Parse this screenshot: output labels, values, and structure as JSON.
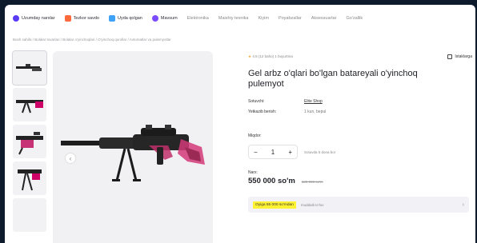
{
  "nav": {
    "items": [
      {
        "label": "Uzumday narxlar",
        "color": "#5b3cf5",
        "icon": "tag-icon"
      },
      {
        "label": "Tezkor savdo",
        "color": "#ff6a3d",
        "icon": "bolt-icon"
      },
      {
        "label": "Uyda qolgan",
        "color": "#3fa2f7",
        "icon": "home-icon"
      },
      {
        "label": "Mavsum",
        "color": "#7b4bff",
        "icon": "sun-icon"
      },
      {
        "label": "Elektronika",
        "color": "",
        "icon": ""
      },
      {
        "label": "Maishiy texnika",
        "color": "",
        "icon": ""
      },
      {
        "label": "Kiyim",
        "color": "",
        "icon": ""
      },
      {
        "label": "Poyabzallar",
        "color": "",
        "icon": ""
      },
      {
        "label": "Aksessuarlar",
        "color": "",
        "icon": ""
      },
      {
        "label": "Go'zallik",
        "color": "",
        "icon": ""
      }
    ]
  },
  "breadcrumbs": "Bosh sahifa / Bolalar tovarlari / Bolalar o'yinchoqlari / O'yinchoq qurollar / Avtomatlar va pulemyotlar",
  "product": {
    "rating_text": "4.5 (12 baho) 1 buyurtma",
    "wishlist_label": "Istaklarga",
    "title": "Gel arbz o'qlari bo'lgan batareyali o'yinchoq pulemyot",
    "meta": [
      {
        "key": "Sotuvchi:",
        "value": "Elite Shop",
        "link": true
      },
      {
        "key": "Yetkazib berish:",
        "value": "1 kun, bepul",
        "link": false
      }
    ],
    "quantity_label": "Miqdor:",
    "quantity": "1",
    "quantity_note": "Sotuvda 5 dona bor",
    "price_label": "Narx:",
    "price": "550 000 so'm",
    "old_price": "620 000 so'm",
    "installment_badge": "Oyiga 55 000 so'mdan",
    "installment_text": "muddatli to'lov"
  }
}
